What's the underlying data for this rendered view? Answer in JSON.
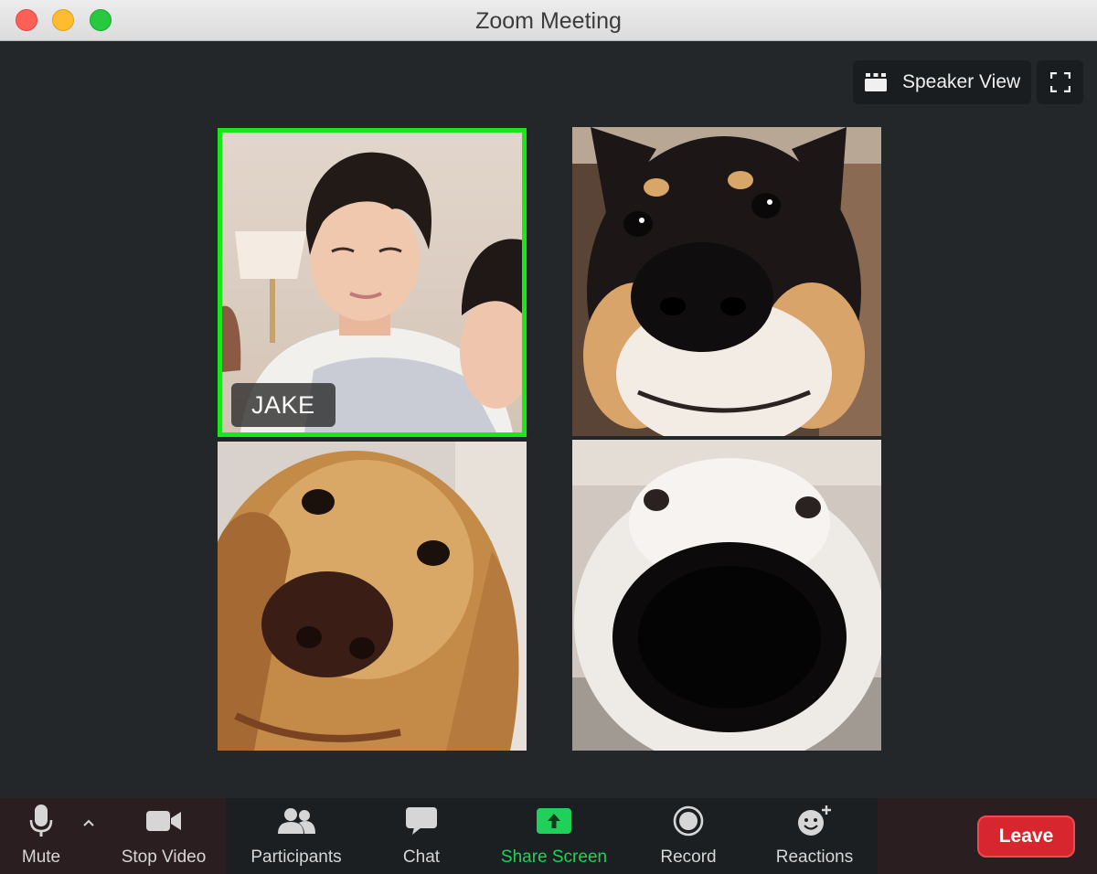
{
  "window": {
    "title": "Zoom Meeting"
  },
  "view_controls": {
    "speaker_view_label": "Speaker View"
  },
  "participants": [
    {
      "name": "JAKE",
      "active_speaker": true
    },
    {
      "name": "",
      "active_speaker": false
    },
    {
      "name": "",
      "active_speaker": false
    },
    {
      "name": "",
      "active_speaker": false
    }
  ],
  "toolbar": {
    "mute_label": "Mute",
    "stop_video_label": "Stop Video",
    "participants_label": "Participants",
    "chat_label": "Chat",
    "share_screen_label": "Share Screen",
    "record_label": "Record",
    "reactions_label": "Reactions",
    "leave_label": "Leave"
  },
  "colors": {
    "active_speaker_border": "#19e61b",
    "share_screen": "#1fd15a",
    "leave": "#d7262e",
    "background": "#232729"
  },
  "icons": {
    "traffic_lights": [
      "close-icon",
      "minimize-icon",
      "zoom-icon"
    ],
    "speaker_view": "grid-icon",
    "fullscreen": "fullscreen-icon",
    "mute": "microphone-icon",
    "mute_options": "chevron-up-icon",
    "video": "video-camera-icon",
    "participants": "people-icon",
    "chat": "chat-bubble-icon",
    "share": "share-arrow-icon",
    "record": "record-icon",
    "reactions": "smiley-plus-icon"
  }
}
